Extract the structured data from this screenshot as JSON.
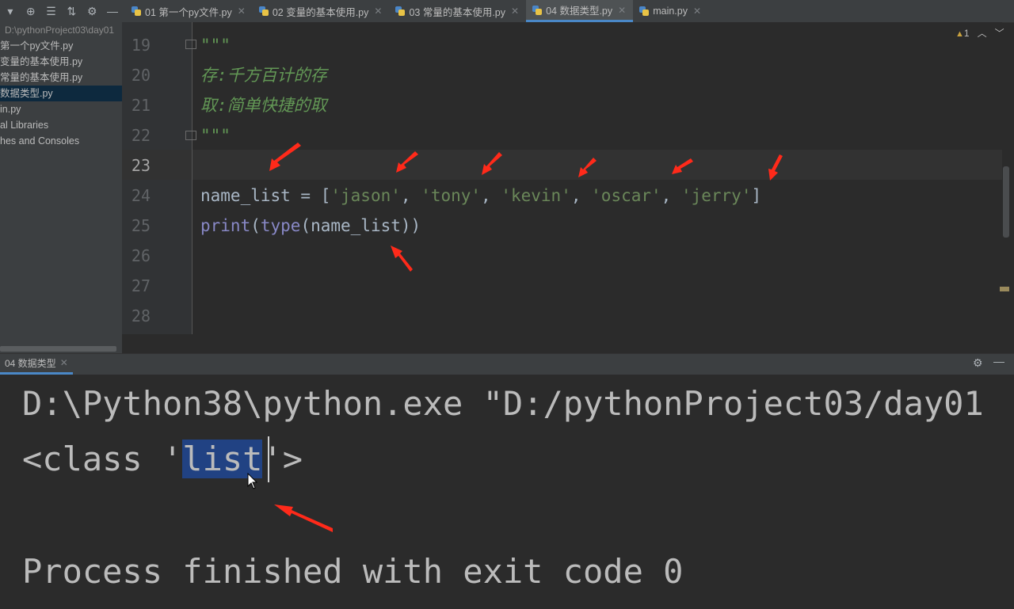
{
  "toolbar": {
    "icons": [
      "dropdown-icon",
      "target-icon",
      "expand-all-icon",
      "collapse-all-icon",
      "gear-icon",
      "minimize-icon"
    ]
  },
  "tabs": [
    {
      "label": "01 第一个py文件.py",
      "active": false
    },
    {
      "label": "02 变量的基本使用.py",
      "active": false
    },
    {
      "label": "03 常量的基本使用.py",
      "active": false
    },
    {
      "label": "04 数据类型.py",
      "active": true
    },
    {
      "label": "main.py",
      "active": false
    }
  ],
  "project": {
    "path": "D:\\pythonProject03\\day01",
    "items": [
      {
        "label": "第一个py文件.py"
      },
      {
        "label": "变量的基本使用.py"
      },
      {
        "label": "常量的基本使用.py"
      },
      {
        "label": "数据类型.py",
        "selected": true
      },
      {
        "label": "in.py"
      },
      {
        "label": "al Libraries"
      },
      {
        "label": "hes and Consoles"
      }
    ]
  },
  "editor": {
    "inspection": {
      "warnings": "1"
    },
    "line_numbers": [
      "19",
      "20",
      "21",
      "22",
      "23",
      "24",
      "25",
      "26",
      "27",
      "28"
    ],
    "line19": "\"\"\"",
    "line20": "存:千方百计的存",
    "line21": "取:简单快捷的取",
    "line22": "\"\"\"",
    "line24": {
      "var": "name_list = [",
      "s1": "'jason'",
      "s2": "'tony'",
      "s3": "'kevin'",
      "s4": "'oscar'",
      "s5": "'jerry'",
      "sep": ", ",
      "close": "]"
    },
    "line25": {
      "fn": "print",
      "p1": "(",
      "fn2": "type",
      "rest": "(name_list))"
    }
  },
  "run": {
    "tab_label": "04 数据类型",
    "output_line1": "D:\\Python38\\python.exe \"D:/pythonProject03/day01",
    "output_line2_pre": "<class '",
    "output_line2_sel": "list",
    "output_line2_post": "'>",
    "output_line3": "Process finished with exit code 0"
  },
  "annotation_color": "#ff2a1a"
}
